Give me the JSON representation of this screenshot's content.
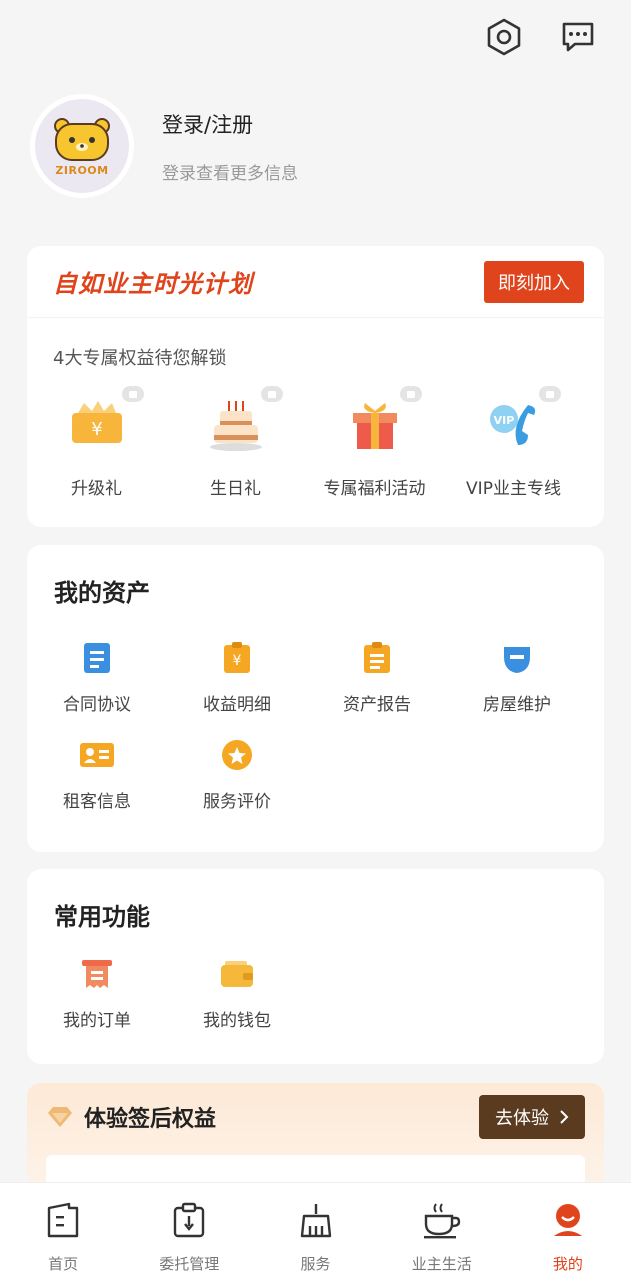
{
  "header": {
    "settings_icon": "settings-hex-icon",
    "message_icon": "message-icon"
  },
  "profile": {
    "brand": "ZIROOM",
    "title": "登录/注册",
    "subtitle": "登录查看更多信息"
  },
  "plan": {
    "title": "自如业主时光计划",
    "join_label": "即刻加入",
    "unlock_text": "4大专属权益待您解锁",
    "perks": [
      {
        "label": "升级礼",
        "icon": "ticket-icon"
      },
      {
        "label": "生日礼",
        "icon": "cake-icon"
      },
      {
        "label": "专属福利活动",
        "icon": "gift-icon"
      },
      {
        "label": "VIP业主专线",
        "icon": "vip-phone-icon"
      }
    ]
  },
  "assets": {
    "title": "我的资产",
    "items": [
      {
        "label": "合同协议",
        "icon": "contract-icon"
      },
      {
        "label": "收益明细",
        "icon": "income-icon"
      },
      {
        "label": "资产报告",
        "icon": "report-icon"
      },
      {
        "label": "房屋维护",
        "icon": "maintenance-icon"
      },
      {
        "label": "租客信息",
        "icon": "tenant-card-icon"
      },
      {
        "label": "服务评价",
        "icon": "rating-icon"
      }
    ]
  },
  "common": {
    "title": "常用功能",
    "items": [
      {
        "label": "我的订单",
        "icon": "order-icon"
      },
      {
        "label": "我的钱包",
        "icon": "wallet-icon"
      }
    ]
  },
  "benefit": {
    "title": "体验签后权益",
    "button_label": "去体验"
  },
  "nav": {
    "items": [
      {
        "label": "首页",
        "icon": "home-icon"
      },
      {
        "label": "委托管理",
        "icon": "entrust-icon"
      },
      {
        "label": "服务",
        "icon": "service-broom-icon"
      },
      {
        "label": "业主生活",
        "icon": "coffee-icon"
      },
      {
        "label": "我的",
        "icon": "profile-icon",
        "active": true
      }
    ]
  },
  "colors": {
    "accent": "#e0441c",
    "brown": "#5a3b1f",
    "orange": "#f5a623",
    "blue": "#3b8fe0"
  }
}
